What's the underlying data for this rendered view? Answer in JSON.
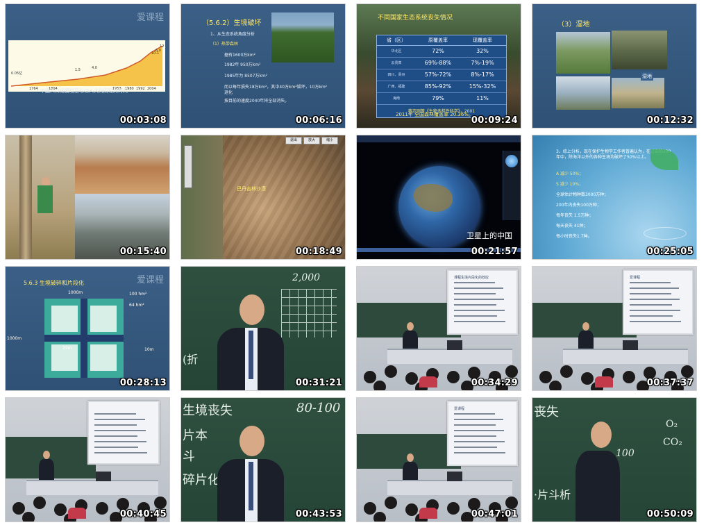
{
  "window": {
    "title": ""
  },
  "thumbnails": [
    {
      "time": "00:03:08",
      "kind": "slide-chart",
      "caption": "中国人口规模增至七亿人大约历经的时间",
      "logo": "爱课程",
      "labels": [
        "0.05亿",
        "1764",
        "1804",
        "1.5",
        "4.0",
        "1953",
        "1980",
        "1992",
        "2004",
        "10.1",
        "6.0",
        "12"
      ]
    },
    {
      "time": "00:06:16",
      "kind": "slide-text-photo",
      "heading": "（5.6.2）生境破坏",
      "lines": [
        "1、从生态系统角度分析",
        "（1）热带森林",
        "据有1600万km²",
        "1982年 950万km²",
        "1985年为 8507万km²",
        "而以每年损失18万km²，其中40万km²毁坏，10万km²退化",
        "按目前的速度2040年将全部消失。"
      ]
    },
    {
      "time": "00:09:24",
      "kind": "slide-table-photo",
      "table_title": "不同国家生态系统丧失情况",
      "columns": [
        "省（区）",
        "原覆盖率",
        "现覆盖率"
      ],
      "rows": [
        [
          "华北区",
          "72%",
          "32%"
        ],
        [
          "云贵高",
          "69%-88%",
          "7%-19%"
        ],
        [
          "四川、贵州",
          "57%-72%",
          "8%-17%"
        ],
        [
          "广西、福建",
          "85%-92%",
          "15%-32%"
        ],
        [
          "海南",
          "79%",
          "11%"
        ]
      ],
      "source": "蒋志刚等《生物多样性科学》，2001",
      "footer": "2011年 全国森林覆盖率 20.36%。"
    },
    {
      "time": "00:12:32",
      "kind": "slide-photos",
      "heading": "（3）湿地",
      "tag": "湿地"
    },
    {
      "time": "00:15:40",
      "kind": "photos-desert"
    },
    {
      "time": "00:18:49",
      "kind": "satellite",
      "label": "巴丹吉林沙漠",
      "buttons": [
        "退出",
        "放大",
        "缩小"
      ]
    },
    {
      "time": "00:21:57",
      "kind": "earth",
      "caption": "卫星上的中国"
    },
    {
      "time": "00:25:05",
      "kind": "slide-water",
      "lines": [
        "3、综上分析，现在保护生物学工作者普遍认为，在过去的200年中，除海洋以外的各种生境均破坏了50%以上。",
        "A 减少 50%；",
        "S 减少 10%；",
        "全球估计物种数3000万种；",
        "200年内丧失100万种；",
        "每年丧失 1.5万种；",
        "每天丧失 41种；",
        "每小时丧失1.7种。"
      ]
    },
    {
      "time": "00:28:13",
      "kind": "slide-diagram",
      "heading": "5.6.3 生境破碎和片段化",
      "logo": "爱课程",
      "labels": [
        "1000m",
        "1000m",
        "100 hm²",
        "64 hm²",
        "20m",
        "10m"
      ]
    },
    {
      "time": "00:31:21",
      "kind": "lecturer-board",
      "board_text": [
        "2,000",
        "(折"
      ]
    },
    {
      "time": "00:34:29",
      "kind": "classroom",
      "screen_title": "课程生境片段化的效应"
    },
    {
      "time": "00:37:37",
      "kind": "classroom",
      "screen_title": "爱课程"
    },
    {
      "time": "00:40:45",
      "kind": "classroom-wide"
    },
    {
      "time": "00:43:53",
      "kind": "lecturer-board",
      "board_text": [
        "生境丧失",
        "片本",
        "斗",
        "碎片化",
        "80-100"
      ]
    },
    {
      "time": "00:47:01",
      "kind": "classroom",
      "screen_title": "爱课程"
    },
    {
      "time": "00:50:09",
      "kind": "lecturer-side",
      "board_text": [
        "丧失",
        "O₂",
        "CO₂",
        "100",
        "·片斗析"
      ]
    }
  ]
}
